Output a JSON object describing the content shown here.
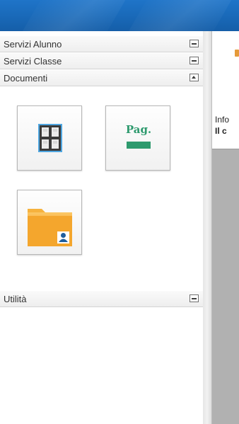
{
  "sidebar": {
    "sections": [
      {
        "label": "Servizi Alunno",
        "state": "collapsed"
      },
      {
        "label": "Servizi Classe",
        "state": "collapsed"
      },
      {
        "label": "Documenti",
        "state": "expanded"
      },
      {
        "label": "Utilità",
        "state": "collapsed"
      }
    ],
    "documents": {
      "tiles": [
        {
          "icon": "grid-window-icon"
        },
        {
          "icon": "page-icon",
          "text": "Pag."
        },
        {
          "icon": "user-folder-icon"
        }
      ]
    }
  },
  "content": {
    "info_line1": "Info",
    "info_line2": "Il c"
  },
  "colors": {
    "header_blue": "#1a6bbb",
    "grid_icon_dark": "#3a3a3a",
    "grid_icon_frame": "#4fa6e0",
    "pag_green": "#2e9a6e",
    "folder_orange": "#f6b23d",
    "user_blue": "#1f5e9e"
  }
}
